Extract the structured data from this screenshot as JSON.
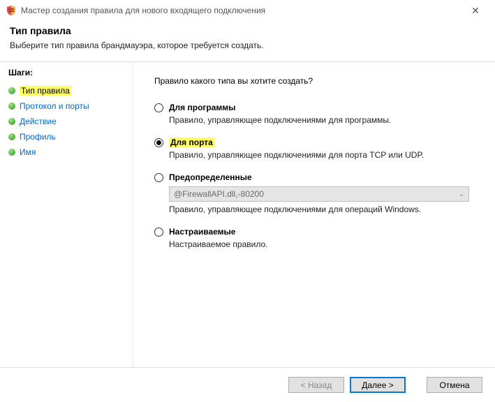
{
  "window": {
    "title": "Мастер создания правила для нового входящего подключения"
  },
  "header": {
    "title": "Тип правила",
    "subtitle": "Выберите тип правила брандмауэра, которое требуется создать."
  },
  "steps": {
    "label": "Шаги:",
    "items": [
      {
        "label": "Тип правила",
        "current": true
      },
      {
        "label": "Протокол и порты"
      },
      {
        "label": "Действие"
      },
      {
        "label": "Профиль"
      },
      {
        "label": "Имя"
      }
    ]
  },
  "content": {
    "prompt": "Правило какого типа вы хотите создать?",
    "options": {
      "program": {
        "label": "Для программы",
        "desc": "Правило, управляющее подключениями для программы."
      },
      "port": {
        "label": "Для порта",
        "desc": "Правило, управляющее подключениями для порта TCP или UDP."
      },
      "predefined": {
        "label": "Предопределенные",
        "combo_value": "@FirewallAPI.dll,-80200",
        "desc": "Правило, управляющее подключениями для операций Windows."
      },
      "custom": {
        "label": "Настраиваемые",
        "desc": "Настраиваемое правило."
      }
    }
  },
  "footer": {
    "back": "< Назад",
    "next": "Далее >",
    "cancel": "Отмена"
  }
}
